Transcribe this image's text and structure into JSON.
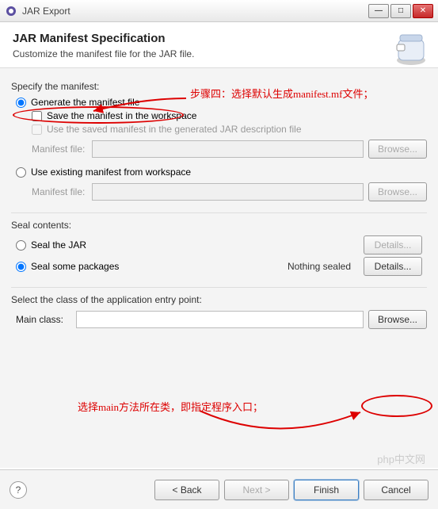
{
  "window": {
    "title": "JAR Export"
  },
  "header": {
    "title": "JAR Manifest Specification",
    "subtitle": "Customize the manifest file for the JAR file."
  },
  "manifest": {
    "section_label": "Specify the manifest:",
    "generate_label": "Generate the manifest file",
    "save_ws_label": "Save the manifest in the workspace",
    "reuse_label": "Use the saved manifest in the generated JAR description file",
    "manifest_file_label": "Manifest file:",
    "browse_label": "Browse...",
    "use_existing_label": "Use existing manifest from workspace"
  },
  "seal": {
    "section_label": "Seal contents:",
    "seal_jar_label": "Seal the JAR",
    "seal_packages_label": "Seal some packages",
    "status_text": "Nothing sealed",
    "details_label": "Details..."
  },
  "entry": {
    "section_label": "Select the class of the application entry point:",
    "main_class_label": "Main class:",
    "browse_label": "Browse..."
  },
  "footer": {
    "back": "< Back",
    "next": "Next >",
    "finish": "Finish",
    "cancel": "Cancel"
  },
  "annotations": {
    "step4": "步骤四：选择默认生成manifest.mf文件；",
    "main_note": "选择main方法所在类，即指定程序入口；"
  },
  "watermark": "php中文网"
}
